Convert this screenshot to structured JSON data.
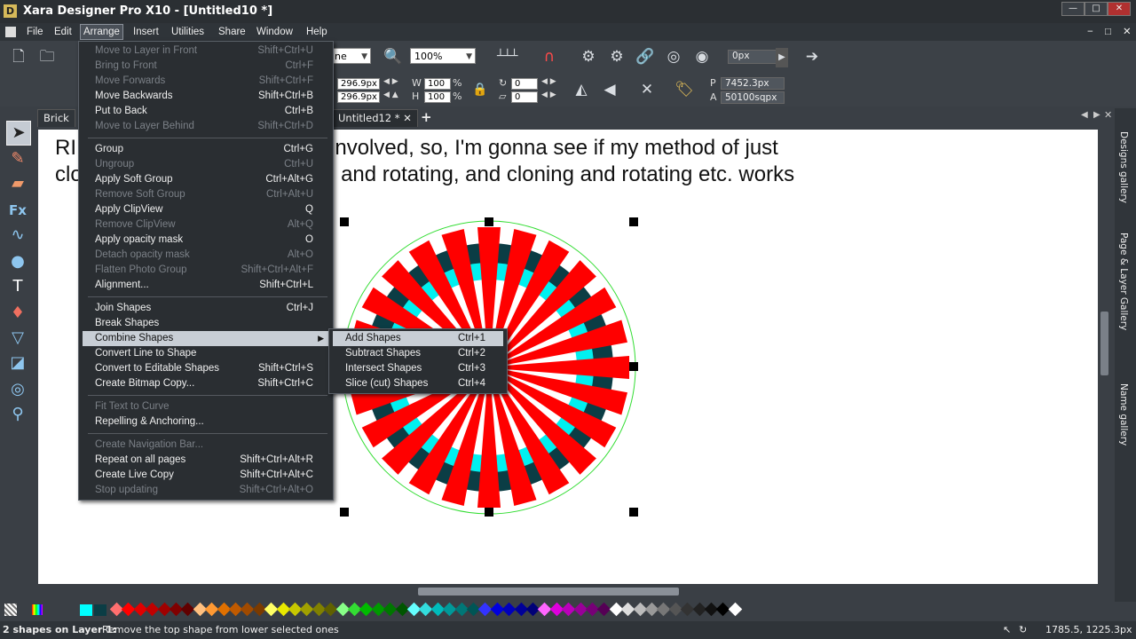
{
  "window": {
    "title": "Xara Designer Pro X10 - [Untitled10 *]",
    "logo": "D",
    "controls": [
      "—",
      "□",
      "✕"
    ],
    "mdi_controls": [
      "−",
      "□",
      "✕"
    ]
  },
  "menubar": [
    "File",
    "Edit",
    "Arrange",
    "Insert",
    "Utilities",
    "Share",
    "Window",
    "Help"
  ],
  "toolbar": {
    "line_combo": "ne",
    "zoom": "100%",
    "px_field": "0px",
    "x_field": "296.9px",
    "y_field": "296.9px",
    "w_label": "W",
    "w_value": "100",
    "h_label": "H",
    "h_value": "100",
    "pct": "%",
    "rot1": "0",
    "rot2": "0",
    "p_label": "P",
    "p_value": "7452.3px",
    "a_label": "A",
    "a_value": "50100sqpx"
  },
  "tabs": [
    "Brick",
    "Untitled12 *"
  ],
  "tab_close": "✕",
  "tab_add": "+",
  "canvas_text": {
    "line1_left": "RI",
    "line1_right": "ns is involved, so, I'm gonna see if my method of just",
    "line2_left": "clo",
    "line2_right": "oning and rotating, and cloning and rotating etc. works"
  },
  "arrange_menu": [
    {
      "label": "Move to Layer in Front",
      "shortcut": "Shift+Ctrl+U",
      "disabled": true
    },
    {
      "label": "Bring to Front",
      "shortcut": "Ctrl+F",
      "disabled": true
    },
    {
      "label": "Move Forwards",
      "shortcut": "Shift+Ctrl+F",
      "disabled": true
    },
    {
      "label": "Move Backwards",
      "shortcut": "Shift+Ctrl+B",
      "disabled": false
    },
    {
      "label": "Put to Back",
      "shortcut": "Ctrl+B",
      "disabled": false
    },
    {
      "label": "Move to Layer Behind",
      "shortcut": "Shift+Ctrl+D",
      "disabled": true
    },
    {
      "sep": true
    },
    {
      "label": "Group",
      "shortcut": "Ctrl+G",
      "disabled": false
    },
    {
      "label": "Ungroup",
      "shortcut": "Ctrl+U",
      "disabled": true
    },
    {
      "label": "Apply Soft Group",
      "shortcut": "Ctrl+Alt+G",
      "disabled": false
    },
    {
      "label": "Remove Soft Group",
      "shortcut": "Ctrl+Alt+U",
      "disabled": true
    },
    {
      "label": "Apply ClipView",
      "shortcut": "Q",
      "disabled": false
    },
    {
      "label": "Remove ClipView",
      "shortcut": "Alt+Q",
      "disabled": true
    },
    {
      "label": "Apply opacity mask",
      "shortcut": "O",
      "disabled": false
    },
    {
      "label": "Detach opacity mask",
      "shortcut": "Alt+O",
      "disabled": true
    },
    {
      "label": "Flatten Photo Group",
      "shortcut": "Shift+Ctrl+Alt+F",
      "disabled": true
    },
    {
      "label": "Alignment...",
      "shortcut": "Shift+Ctrl+L",
      "disabled": false
    },
    {
      "sep": true
    },
    {
      "label": "Join Shapes",
      "shortcut": "Ctrl+J",
      "disabled": false
    },
    {
      "label": "Break Shapes",
      "shortcut": "",
      "disabled": false
    },
    {
      "label": "Combine Shapes",
      "shortcut": "",
      "disabled": false,
      "highlight": true,
      "submenu": true
    },
    {
      "label": "Convert Line to Shape",
      "shortcut": "",
      "disabled": false
    },
    {
      "label": "Convert to Editable Shapes",
      "shortcut": "Shift+Ctrl+S",
      "disabled": false
    },
    {
      "label": "Create Bitmap Copy...",
      "shortcut": "Shift+Ctrl+C",
      "disabled": false
    },
    {
      "sep": true
    },
    {
      "label": "Fit Text to Curve",
      "shortcut": "",
      "disabled": true
    },
    {
      "label": "Repelling & Anchoring...",
      "shortcut": "",
      "disabled": false
    },
    {
      "sep": true
    },
    {
      "label": "Create Navigation Bar...",
      "shortcut": "",
      "disabled": true
    },
    {
      "label": "Repeat on all pages",
      "shortcut": "Shift+Ctrl+Alt+R",
      "disabled": false
    },
    {
      "label": "Create Live Copy",
      "shortcut": "Shift+Ctrl+Alt+C",
      "disabled": false
    },
    {
      "label": "Stop updating",
      "shortcut": "Shift+Ctrl+Alt+O",
      "disabled": true
    }
  ],
  "combine_submenu": [
    {
      "label": "Add Shapes",
      "shortcut": "Ctrl+1",
      "highlight": true
    },
    {
      "label": "Subtract Shapes",
      "shortcut": "Ctrl+2"
    },
    {
      "label": "Intersect Shapes",
      "shortcut": "Ctrl+3"
    },
    {
      "label": "Slice (cut) Shapes",
      "shortcut": "Ctrl+4"
    }
  ],
  "galleries": [
    "Designs gallery",
    "Page & Layer Gallery",
    "Name gallery"
  ],
  "status": {
    "bold": "2 shapes on Layer 1:",
    "message": "Remove the top shape from lower selected ones",
    "coords": "1785.5, 1225.3px"
  },
  "palette_colors": [
    "#ff6f6f",
    "#ff0000",
    "#e00000",
    "#c00000",
    "#a00000",
    "#800000",
    "#600000",
    "#ffc080",
    "#ff9933",
    "#e07000",
    "#c05a00",
    "#a04a00",
    "#7a3a00",
    "#ffff66",
    "#e8e800",
    "#c8c800",
    "#a0a000",
    "#808000",
    "#606000",
    "#88ff88",
    "#33dd33",
    "#00bb00",
    "#009900",
    "#007700",
    "#005500",
    "#66ffff",
    "#33dddd",
    "#00bbbb",
    "#009999",
    "#007777",
    "#005555",
    "#3333ff",
    "#0000dd",
    "#0000bb",
    "#000099",
    "#000077",
    "#ff66ff",
    "#dd00dd",
    "#bb00bb",
    "#990099",
    "#770077",
    "#550055",
    "#ffffff",
    "#dddddd",
    "#bbbbbb",
    "#999999",
    "#777777",
    "#555555",
    "#333333",
    "#222222",
    "#111111",
    "#000000",
    "#ffffff"
  ],
  "art": {
    "ring_outer": "#0b3d45",
    "ring_cyan": "#00f0f0",
    "spoke": "#ff0000",
    "guide": "#33dd33"
  }
}
